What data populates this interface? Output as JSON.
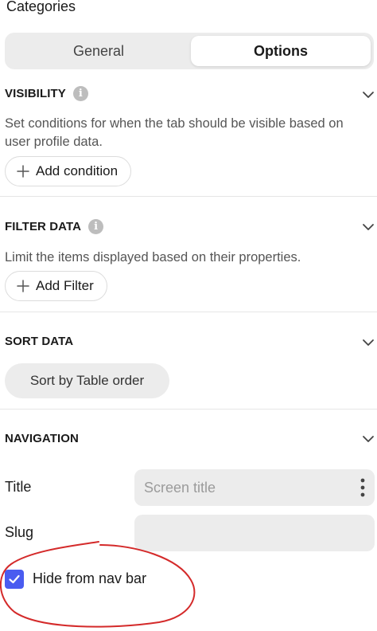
{
  "page": {
    "title": "Categories"
  },
  "tabs": [
    {
      "label": "General",
      "active": false
    },
    {
      "label": "Options",
      "active": true
    }
  ],
  "visibility": {
    "heading": "VISIBILITY",
    "description": "Set conditions for when the tab should be visible based on user profile data.",
    "button": "Add condition"
  },
  "filter": {
    "heading": "FILTER DATA",
    "description": "Limit the items displayed based on their properties.",
    "button": "Add Filter"
  },
  "sort": {
    "heading": "SORT DATA",
    "button": "Sort by Table order"
  },
  "navigation": {
    "heading": "NAVIGATION",
    "title_label": "Title",
    "title_placeholder": "Screen title",
    "slug_label": "Slug",
    "slug_value": "",
    "hide_label": "Hide from nav bar",
    "hide_checked": true
  },
  "colors": {
    "accent": "#4a5cf0",
    "annotation": "#d42a2a"
  }
}
